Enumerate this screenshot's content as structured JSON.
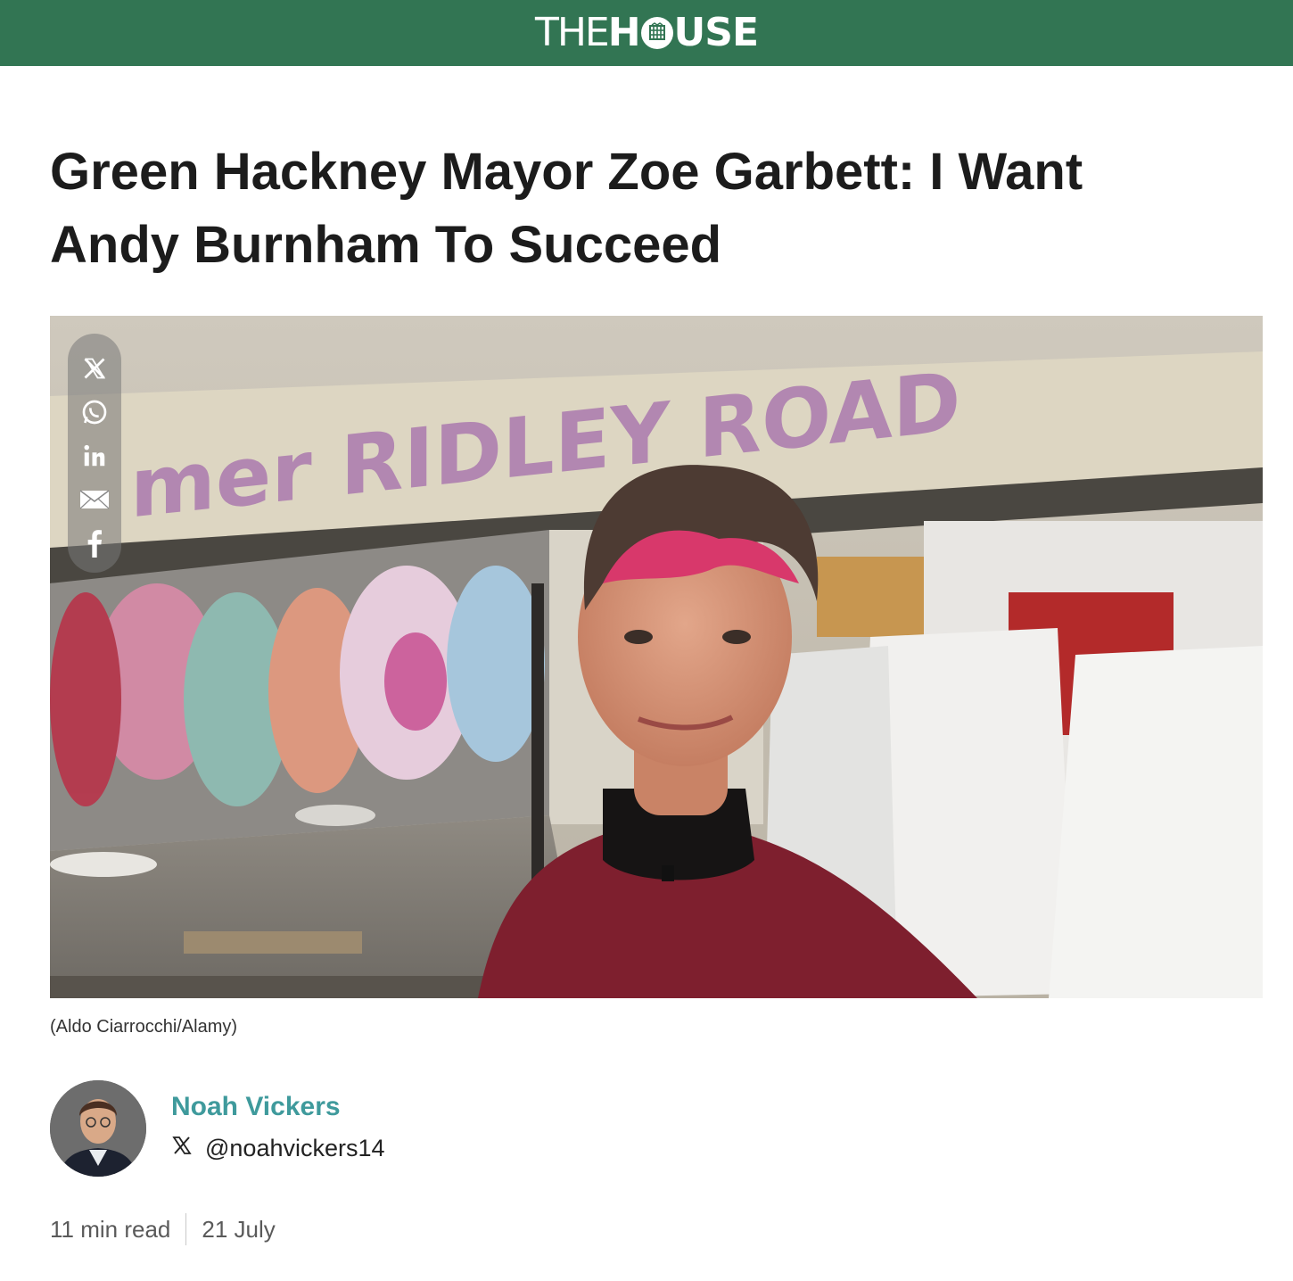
{
  "header": {
    "logo_thin": "THE",
    "logo_bold_pre": "H",
    "logo_bold_post": "USE",
    "brand_color": "#327553"
  },
  "article": {
    "title": "Green Hackney Mayor Zoe Garbett: I Want Andy Burnham To Succeed",
    "image_caption": "(Aldo Ciarrocchi/Alamy)",
    "image_sign_text": "mer RIDLEY ROAD"
  },
  "share": {
    "buttons": [
      "x-icon",
      "whatsapp-icon",
      "linkedin-icon",
      "email-icon",
      "facebook-icon"
    ]
  },
  "author": {
    "name": "Noah Vickers",
    "handle": "@noahvickers14",
    "name_color": "#3f9a9c"
  },
  "meta": {
    "read_time": "11 min read",
    "date": "21 July"
  }
}
